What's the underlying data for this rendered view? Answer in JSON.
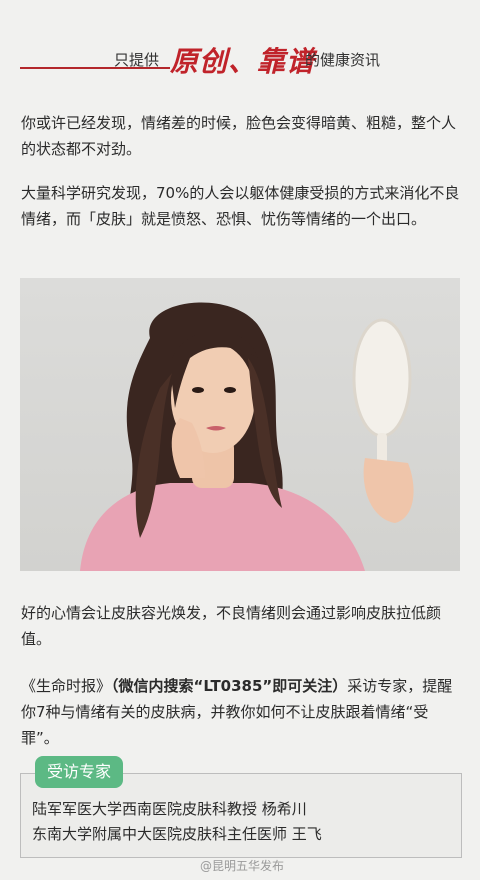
{
  "header": {
    "prefix": "只提供",
    "brand": "原创、靠谱",
    "suffix": "的健康资讯"
  },
  "paragraphs": {
    "p1": "你或许已经发现，情绪差的时候，脸色会变得暗黄、粗糙，整个人的状态都不对劲。",
    "p2": "大量科学研究发现，70%的人会以躯体健康受损的方式来消化不良情绪，而「皮肤」就是愤怒、恐惧、忧伤等情绪的一个出口。",
    "p3": "好的心情会让皮肤容光焕发，不良情绪则会通过影响皮肤拉低颜值。",
    "p4_a": "《生命时报》",
    "p4_b": "（微信内搜索“LT0385”即可关注）",
    "p4_c": "采访专家，提醒你7种与情绪有关的皮肤病，并教你如何不让皮肤跟着情绪“受罪”。"
  },
  "expert": {
    "tag": "受访专家",
    "line1": "陆军军医大学西南医院皮肤科教授  杨希川",
    "line2": "东南大学附属中大医院皮肤科主任医师  王飞"
  },
  "watermark": "@昆明五华发布"
}
